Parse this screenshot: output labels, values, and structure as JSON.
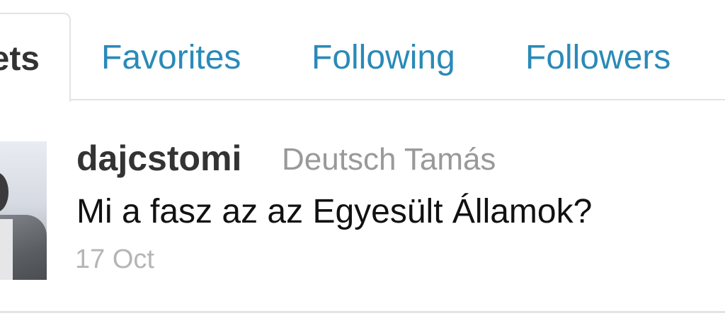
{
  "tabs": {
    "tweets_partial": "ets",
    "favorites": "Favorites",
    "following": "Following",
    "followers": "Followers"
  },
  "tweet": {
    "username": "dajcstomi",
    "fullname": "Deutsch Tamás",
    "text": "Mi a fasz az az Egyesült Államok?",
    "timestamp": "17 Oct"
  },
  "colors": {
    "link": "#2a8ab8",
    "username": "#333333",
    "muted": "#999999",
    "timestamp": "#b5b5b5",
    "border": "#e3e3e3"
  }
}
